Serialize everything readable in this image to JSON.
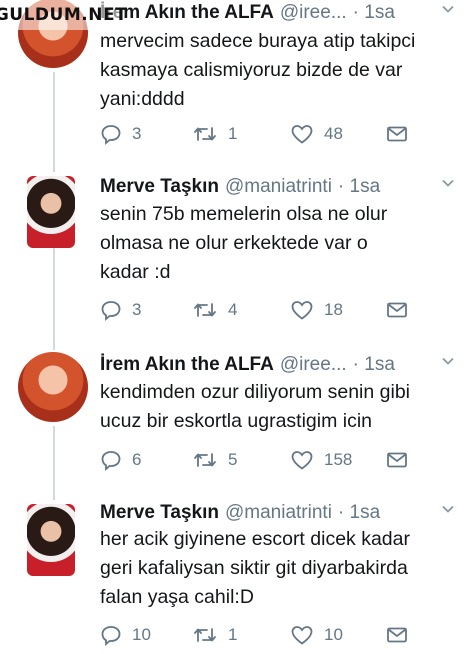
{
  "watermark": "GULDUM.NET",
  "tweets": [
    {
      "name": "İrem Akın the ALFA",
      "handle": "@iree...",
      "time": "· 1sa",
      "text": [
        "mervecim sadece buraya atip takipci",
        "kasmaya calismiyoruz bizde de var",
        "yani:dddd"
      ],
      "replies": "3",
      "retweets": "1",
      "likes": "48"
    },
    {
      "name": "Merve Taşkın",
      "handle": "@maniatrinti",
      "time": "· 1sa",
      "text": [
        "senin 75b memelerin olsa ne olur",
        "olmasa ne olur erkektede var o",
        "kadar :d"
      ],
      "replies": "3",
      "retweets": "4",
      "likes": "18"
    },
    {
      "name": "İrem Akın the ALFA",
      "handle": "@iree...",
      "time": "· 1sa",
      "text": [
        "kendimden ozur diliyorum senin gibi",
        "ucuz bir eskortla ugrastigim icin"
      ],
      "replies": "6",
      "retweets": "5",
      "likes": "158"
    },
    {
      "name": "Merve Taşkın",
      "handle": "@maniatrinti",
      "time": "· 1sa",
      "text": [
        "her acik giyinene escort dicek kadar",
        "geri kafaliysan siktir git diyarbakirda",
        "falan yaşa cahil:D"
      ],
      "replies": "10",
      "retweets": "1",
      "likes": "10"
    }
  ]
}
